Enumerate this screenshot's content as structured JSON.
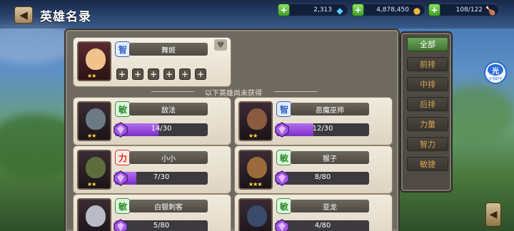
{
  "header": {
    "title": "英雄名录",
    "back_icon": "back-arrow-icon"
  },
  "resources": [
    {
      "name": "diamonds",
      "value": "2,313",
      "icon": "diamond-icon",
      "color": "#4fd1ff"
    },
    {
      "name": "gold",
      "value": "4,878,450",
      "icon": "gold-coins-icon",
      "color": "#f2b63a"
    },
    {
      "name": "stamina",
      "value": "108/122",
      "icon": "drumstick-icon",
      "color": "#e07a3b"
    }
  ],
  "owned_hero": {
    "name": "舞姬",
    "attribute": "智",
    "attribute_type": "int",
    "stars": "★★",
    "equip_slots": [
      "+",
      "+",
      "+",
      "+",
      "+",
      "+"
    ]
  },
  "divider_text": "以下英雄尚未获得",
  "heroes": [
    {
      "name": "敌法",
      "attribute": "敏",
      "attribute_type": "agi",
      "progress": "14/30",
      "fraction": 0.467,
      "stars": "★★",
      "face": "#6c7a86"
    },
    {
      "name": "恶魔巫师",
      "attribute": "智",
      "attribute_type": "int",
      "progress": "12/30",
      "fraction": 0.4,
      "stars": "★★",
      "face": "#8a5b3e"
    },
    {
      "name": "小小",
      "attribute": "力",
      "attribute_type": "str",
      "progress": "7/30",
      "fraction": 0.233,
      "stars": "★★",
      "face": "#5c6d3a"
    },
    {
      "name": "猴子",
      "attribute": "敏",
      "attribute_type": "agi",
      "progress": "8/80",
      "fraction": 0.1,
      "stars": "★★★",
      "face": "#9a6a3a"
    },
    {
      "name": "白银刺客",
      "attribute": "敏",
      "attribute_type": "agi",
      "progress": "5/80",
      "fraction": 0.0625,
      "stars": "",
      "face": "#b7bcc6"
    },
    {
      "name": "亚龙",
      "attribute": "敏",
      "attribute_type": "agi",
      "progress": "4/80",
      "fraction": 0.05,
      "stars": "",
      "face": "#3a4a6a"
    }
  ],
  "filters": [
    "全部",
    "前排",
    "中排",
    "后排",
    "力量",
    "智力",
    "敏捷"
  ],
  "active_filter": "全部",
  "float_button": {
    "main": "光",
    "sub": "大师助手"
  }
}
